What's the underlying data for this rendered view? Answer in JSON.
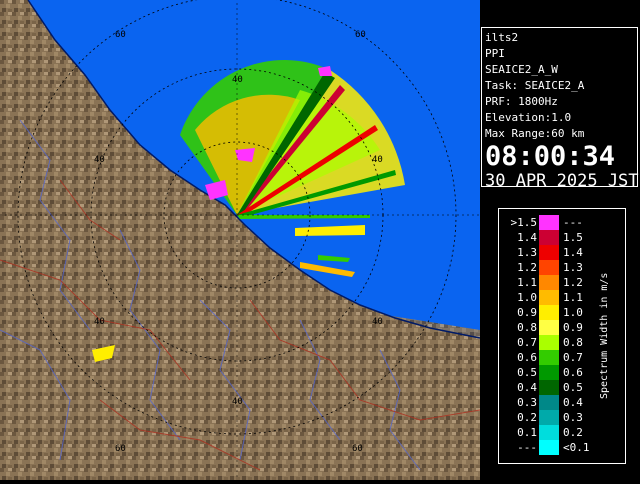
{
  "info": {
    "station": "ilts2",
    "mode": "PPI",
    "volume": "SEAICE2_A_W",
    "task": "Task: SEAICE2_A",
    "prf": "PRF: 1800Hz",
    "elevation": "Elevation:1.0",
    "max_range": "Max Range:60 km",
    "time": "08:00:34",
    "date": "30 APR 2025 JST"
  },
  "legend": {
    "title": "Spectrum Width in m/s",
    "rows": [
      {
        "lo": ">1.5",
        "hi": "---",
        "color": "#ff33ff"
      },
      {
        "lo": "1.4",
        "hi": "1.5",
        "color": "#cc0033"
      },
      {
        "lo": "1.3",
        "hi": "1.4",
        "color": "#ee0000"
      },
      {
        "lo": "1.2",
        "hi": "1.3",
        "color": "#ff4400"
      },
      {
        "lo": "1.1",
        "hi": "1.2",
        "color": "#ff8800"
      },
      {
        "lo": "1.0",
        "hi": "1.1",
        "color": "#ffbb00"
      },
      {
        "lo": "0.9",
        "hi": "1.0",
        "color": "#ffee00"
      },
      {
        "lo": "0.8",
        "hi": "0.9",
        "color": "#ffff44"
      },
      {
        "lo": "0.7",
        "hi": "0.8",
        "color": "#aaff00"
      },
      {
        "lo": "0.6",
        "hi": "0.7",
        "color": "#33cc00"
      },
      {
        "lo": "0.5",
        "hi": "0.6",
        "color": "#009900"
      },
      {
        "lo": "0.4",
        "hi": "0.5",
        "color": "#006600"
      },
      {
        "lo": "0.3",
        "hi": "0.4",
        "color": "#008888"
      },
      {
        "lo": "0.2",
        "hi": "0.3",
        "color": "#00aaaa"
      },
      {
        "lo": "0.1",
        "hi": "0.2",
        "color": "#00dddd"
      },
      {
        "lo": "---",
        "hi": "<0.1",
        "color": "#00ffff"
      }
    ]
  },
  "map": {
    "sea_color": "#0a64f0",
    "land_color": "#8a7355",
    "range_labels": [
      "40",
      "60"
    ]
  }
}
